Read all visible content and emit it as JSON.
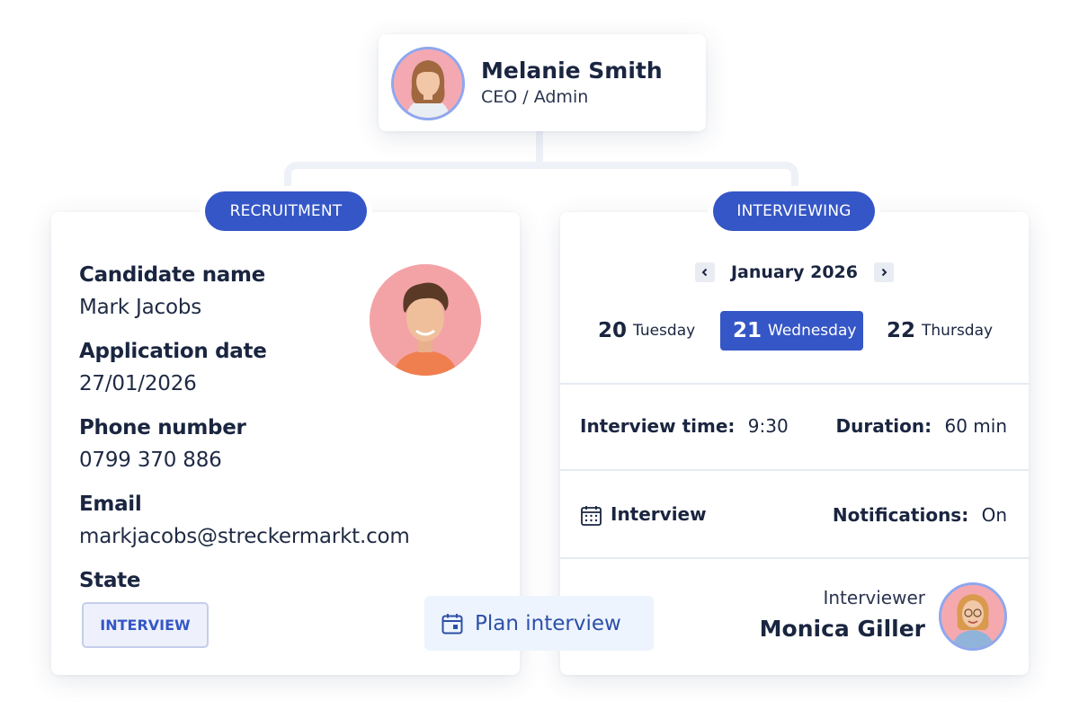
{
  "admin": {
    "name": "Melanie Smith",
    "role": "CEO / Admin"
  },
  "recruitment": {
    "tag": "RECRUITMENT",
    "fields": [
      {
        "label": "Candidate name",
        "value": "Mark Jacobs"
      },
      {
        "label": "Application date",
        "value": "27/01/2026"
      },
      {
        "label": "Phone number",
        "value": "0799 370 886"
      },
      {
        "label": "Email",
        "value": "markjacobs@streckermarkt.com"
      }
    ],
    "state_label": "State",
    "state_value": "INTERVIEW",
    "plan_button": "Plan interview"
  },
  "interviewing": {
    "tag": "INTERVIEWING",
    "month": "January 2026",
    "days": [
      {
        "num": "20",
        "weekday": "Tuesday"
      },
      {
        "num": "21",
        "weekday": "Wednesday",
        "selected": true
      },
      {
        "num": "22",
        "weekday": "Thursday"
      }
    ],
    "interview_time_label": "Interview time:",
    "interview_time_value": "9:30",
    "duration_label": "Duration:",
    "duration_value": "60 min",
    "event_label": "Interview",
    "notifications_label": "Notifications:",
    "notifications_value": "On",
    "interviewer_label": "Interviewer",
    "interviewer_name": "Monica Giller"
  },
  "colors": {
    "accent": "#3556c6",
    "text": "#1a2540",
    "connector": "#eef1f7"
  },
  "icons": {
    "prev": "chevron-left-icon",
    "next": "chevron-right-icon",
    "calendar": "calendar-icon"
  }
}
